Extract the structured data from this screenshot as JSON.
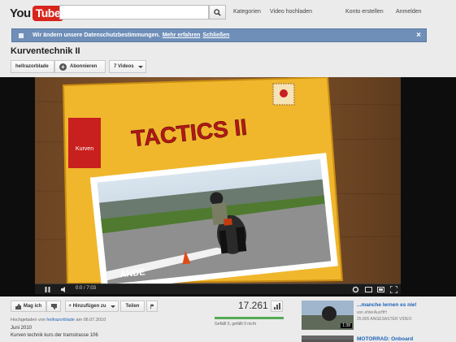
{
  "header": {
    "logo_you": "You",
    "logo_tube": "Tube",
    "search_placeholder": "",
    "nav": [
      "Kategorien",
      "Video hochladen"
    ],
    "account": [
      "Konto erstellen",
      "Anmelden"
    ]
  },
  "notice": {
    "text": "Wir ändern unsere Datenschutzbestimmungen.",
    "link_more": "Mehr erfahren",
    "link_close": "Schließen",
    "close_glyph": "×"
  },
  "video": {
    "title": "Kurventechnik II",
    "channel_button": "hellrazorblade",
    "subscribe_label": "Abonnieren",
    "videos_label": "7 Videos",
    "overlay_title": "TACTICS II",
    "overlay_tag": "Kurven",
    "time": "0:0 / 7:03",
    "progress": 0.0
  },
  "actions": {
    "like": "Mag ich",
    "add": "+ Hinzufügen zu",
    "share": "Teilen"
  },
  "stats": {
    "views": "17.261",
    "likes_text": "Gefällt 5, gefällt 0 nicht",
    "like_ratio": 1.0
  },
  "upload": {
    "prefix": "Hochgeladen von",
    "channel": "hellrazorblade",
    "date": "am 06.07.2010"
  },
  "description": {
    "line1": "Juni 2010",
    "line2": "Kurven technik kurs der tramstrasse 106"
  },
  "related": [
    {
      "title": "...manche lernen es nie!",
      "meta1": "von ehterAusHH",
      "meta2": "25.805  ANGESASTER VIDEO",
      "duration": "1:38"
    },
    {
      "title": "MOTORRAD: Onboard",
      "meta1": "",
      "meta2": "",
      "duration": ""
    }
  ],
  "colors": {
    "brand_red": "#d8251c",
    "notice_blue": "#6f8fb9",
    "link_blue": "#1c62b9"
  }
}
